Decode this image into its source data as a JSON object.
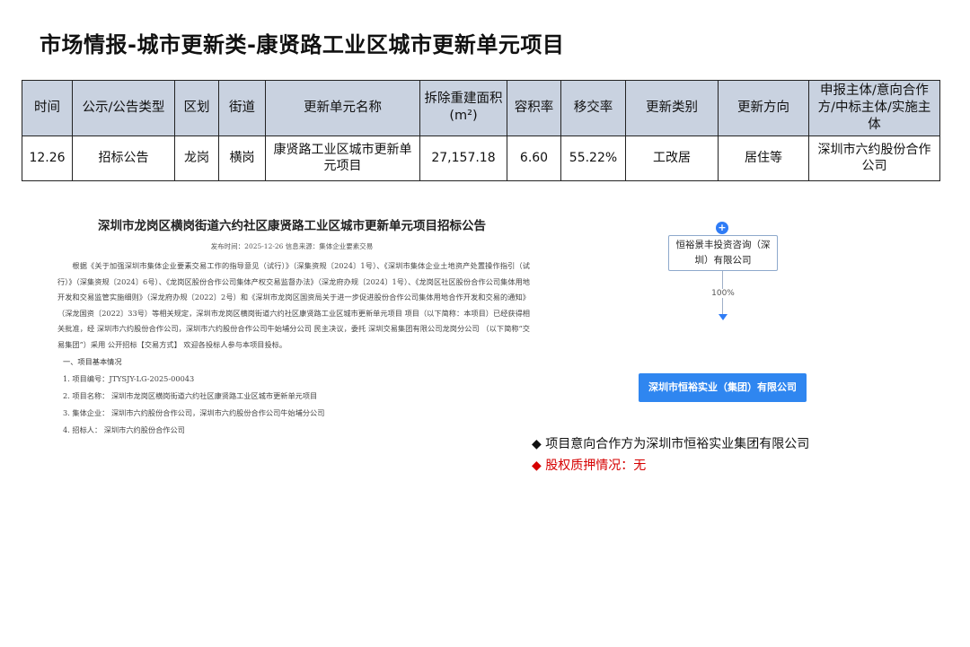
{
  "page": {
    "title": "市场情报-城市更新类-康贤路工业区城市更新单元项目"
  },
  "table": {
    "headers": [
      "时间",
      "公示/公告类型",
      "区划",
      "街道",
      "更新单元名称",
      "拆除重建面积(m²)",
      "容积率",
      "移交率",
      "更新类别",
      "更新方向",
      "申报主体/意向合作方/中标主体/实施主体"
    ],
    "row": [
      "12.26",
      "招标公告",
      "龙岗",
      "横岗",
      "康贤路工业区城市更新单元项目",
      "27,157.18",
      "6.60",
      "55.22%",
      "工改居",
      "居住等",
      "深圳市六约股份合作公司"
    ]
  },
  "doc": {
    "title": "深圳市龙岗区横岗街道六约社区康贤路工业区城市更新单元项目招标公告",
    "meta": "发布时间：2025-12-26    信息来源：集体企业要素交易",
    "body": "根据《关于加强深圳市集体企业要素交易工作的指导意见（试行）》（深集资规〔2024〕1号）、《深圳市集体企业土地资产处置操作指引（试行）》（深集资规〔2024〕6号）、《龙岗区股份合作公司集体产权交易监督办法》（深龙府办规〔2024〕1号）、《龙岗区社区股份合作公司集体用地开发和交易监管实施细则》（深龙府办规〔2022〕2号）和《深圳市龙岗区国资局关于进一步促进股份合作公司集体用地合作开发和交易的通知》（深龙国资〔2022〕33号）等相关规定，深圳市龙岗区横岗街道六约社区康贤路工业区城市更新单元项目 项目（以下简称：本项目）已经获得相关批准，经 深圳市六约股份合作公司，深圳市六约股份合作公司牛始埔分公司 民主决议，委托 深圳交易集团有限公司龙岗分公司 （以下简称“交易集团”）采用 公开招标【交易方式】 欢迎各投标人参与本项目投标。",
    "section": "一、项目基本情况",
    "items": [
      "1. 项目编号：JTYSJY-LG-2025-00043",
      "2. 项目名称： 深圳市龙岗区横岗街道六约社区康贤路工业区城市更新单元项目",
      "3. 集体企业： 深圳市六约股份合作公司，深圳市六约股份合作公司牛始埔分公司",
      "4. 招标人： 深圳市六约股份合作公司"
    ]
  },
  "diagram": {
    "plus": "+",
    "shareholder": "恒裕景丰投资咨询（深圳）有限公司",
    "percent": "100%",
    "company": "深圳市恒裕实业（集团）有限公司",
    "accent": "#2f86f0"
  },
  "notes": [
    {
      "text": "◆ 项目意向合作方为深圳市恒裕实业集团有限公司",
      "color": "#111111"
    },
    {
      "text": "◆ 股权质押情况：无",
      "color": "#d60000"
    }
  ]
}
